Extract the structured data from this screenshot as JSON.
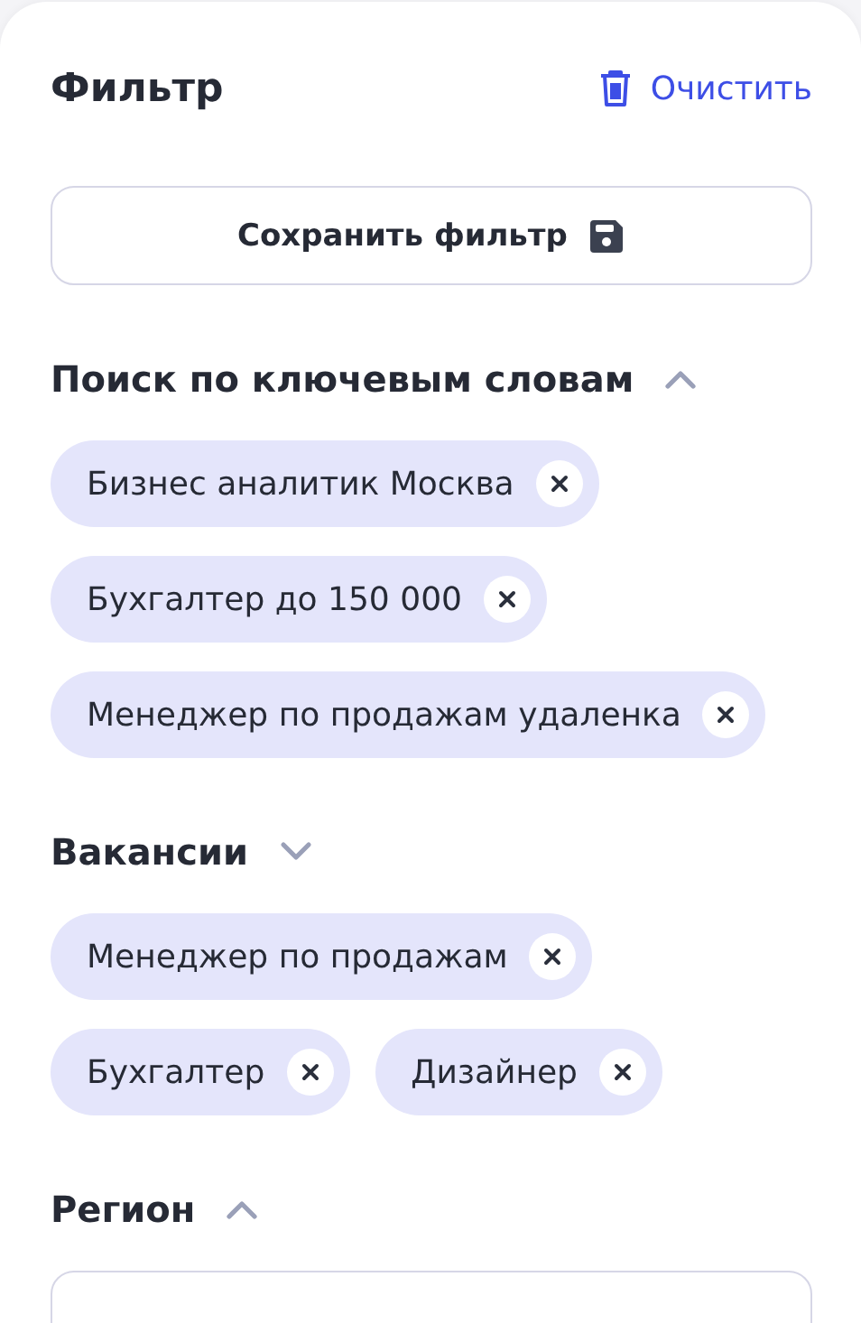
{
  "header": {
    "title": "Фильтр",
    "clear_button": "Очистить"
  },
  "save_button": "Сохранить фильтр",
  "sections": [
    {
      "title": "Поиск по ключевым словам",
      "expanded": true,
      "kind": "chips",
      "chips": [
        "Бизнес аналитик Москва",
        "Бухгалтер до 150 000",
        "Менеджер по продажам удаленка"
      ]
    },
    {
      "title": "Вакансии",
      "expanded": false,
      "kind": "chips",
      "chips": [
        "Менеджер по продажам",
        "Бухгалтер",
        "Дизайнер"
      ]
    },
    {
      "title": "Регион",
      "expanded": true,
      "kind": "field"
    }
  ]
}
